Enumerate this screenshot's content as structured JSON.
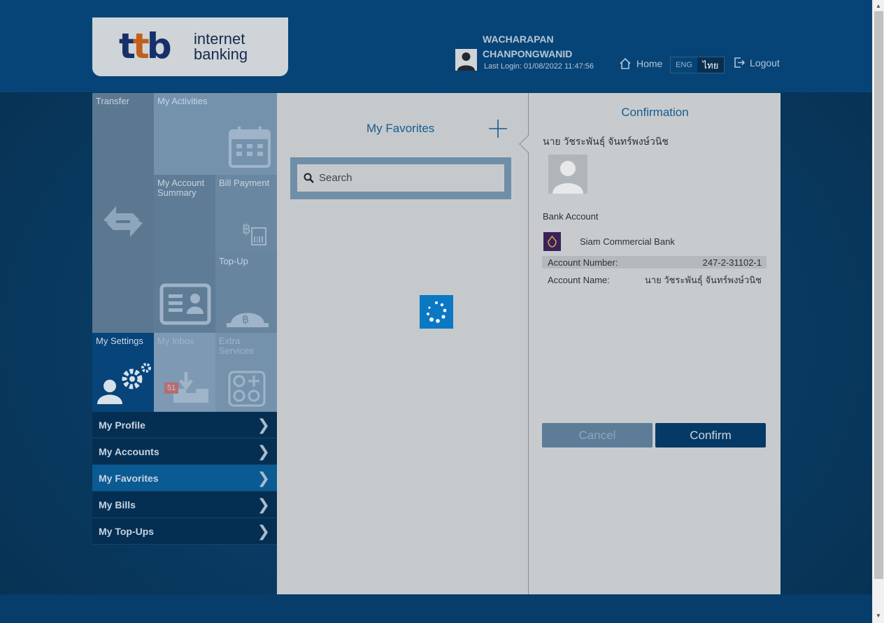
{
  "header": {
    "logo_ttb": "ttb",
    "logo_line1": "internet",
    "logo_line2": "banking",
    "user_name_line1": "WACHARAPAN",
    "user_name_line2": "CHANPONGWANID",
    "last_login": "Last Login: 01/08/2022 11:47:56",
    "home_label": "Home",
    "lang_eng": "ENG",
    "lang_th": "ไทย",
    "logout_label": "Logout"
  },
  "tiles": {
    "transfer": "Transfer",
    "my_activities": "My Activities",
    "my_account_summary": "My Account Summary",
    "bill_payment": "Bill Payment",
    "top_up": "Top-Up",
    "my_settings": "My Settings",
    "my_inbox": "My Inbox",
    "inbox_count": "51",
    "extra_services": "Extra Services"
  },
  "menu": {
    "items": [
      {
        "label": "My Profile",
        "active": false
      },
      {
        "label": "My Accounts",
        "active": false
      },
      {
        "label": "My Favorites",
        "active": true
      },
      {
        "label": "My Bills",
        "active": false
      },
      {
        "label": "My Top-Ups",
        "active": false
      }
    ]
  },
  "favorites": {
    "title": "My Favorites",
    "search_placeholder": "Search"
  },
  "confirmation": {
    "title": "Confirmation",
    "payee_name": "นาย วัชระพันธุ์ จันทร์พงษ์วนิช",
    "bank_account_label": "Bank Account",
    "bank_name": "Siam Commercial Bank",
    "account_number_label": "Account Number:",
    "account_number": "247-2-31102-1",
    "account_name_label": "Account Name:",
    "account_name": "นาย วัชระพันธุ์ จันทร์พงษ์วนิช",
    "cancel_label": "Cancel",
    "confirm_label": "Confirm"
  },
  "colors": {
    "brand_blue": "#155c8f",
    "active_menu": "#0a5a93",
    "confirm_button": "#053a66"
  }
}
